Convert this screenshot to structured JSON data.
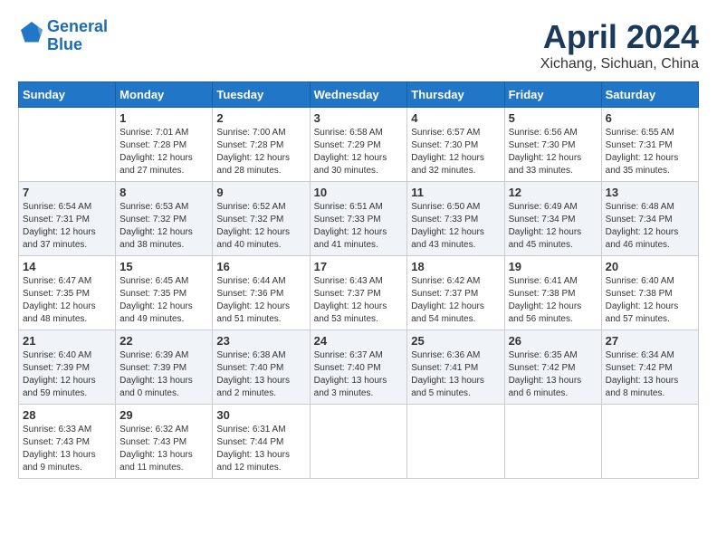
{
  "logo": {
    "line1": "General",
    "line2": "Blue"
  },
  "title": "April 2024",
  "subtitle": "Xichang, Sichuan, China",
  "days_of_week": [
    "Sunday",
    "Monday",
    "Tuesday",
    "Wednesday",
    "Thursday",
    "Friday",
    "Saturday"
  ],
  "weeks": [
    [
      {
        "num": "",
        "info": ""
      },
      {
        "num": "1",
        "info": "Sunrise: 7:01 AM\nSunset: 7:28 PM\nDaylight: 12 hours\nand 27 minutes."
      },
      {
        "num": "2",
        "info": "Sunrise: 7:00 AM\nSunset: 7:28 PM\nDaylight: 12 hours\nand 28 minutes."
      },
      {
        "num": "3",
        "info": "Sunrise: 6:58 AM\nSunset: 7:29 PM\nDaylight: 12 hours\nand 30 minutes."
      },
      {
        "num": "4",
        "info": "Sunrise: 6:57 AM\nSunset: 7:30 PM\nDaylight: 12 hours\nand 32 minutes."
      },
      {
        "num": "5",
        "info": "Sunrise: 6:56 AM\nSunset: 7:30 PM\nDaylight: 12 hours\nand 33 minutes."
      },
      {
        "num": "6",
        "info": "Sunrise: 6:55 AM\nSunset: 7:31 PM\nDaylight: 12 hours\nand 35 minutes."
      }
    ],
    [
      {
        "num": "7",
        "info": "Sunrise: 6:54 AM\nSunset: 7:31 PM\nDaylight: 12 hours\nand 37 minutes."
      },
      {
        "num": "8",
        "info": "Sunrise: 6:53 AM\nSunset: 7:32 PM\nDaylight: 12 hours\nand 38 minutes."
      },
      {
        "num": "9",
        "info": "Sunrise: 6:52 AM\nSunset: 7:32 PM\nDaylight: 12 hours\nand 40 minutes."
      },
      {
        "num": "10",
        "info": "Sunrise: 6:51 AM\nSunset: 7:33 PM\nDaylight: 12 hours\nand 41 minutes."
      },
      {
        "num": "11",
        "info": "Sunrise: 6:50 AM\nSunset: 7:33 PM\nDaylight: 12 hours\nand 43 minutes."
      },
      {
        "num": "12",
        "info": "Sunrise: 6:49 AM\nSunset: 7:34 PM\nDaylight: 12 hours\nand 45 minutes."
      },
      {
        "num": "13",
        "info": "Sunrise: 6:48 AM\nSunset: 7:34 PM\nDaylight: 12 hours\nand 46 minutes."
      }
    ],
    [
      {
        "num": "14",
        "info": "Sunrise: 6:47 AM\nSunset: 7:35 PM\nDaylight: 12 hours\nand 48 minutes."
      },
      {
        "num": "15",
        "info": "Sunrise: 6:45 AM\nSunset: 7:35 PM\nDaylight: 12 hours\nand 49 minutes."
      },
      {
        "num": "16",
        "info": "Sunrise: 6:44 AM\nSunset: 7:36 PM\nDaylight: 12 hours\nand 51 minutes."
      },
      {
        "num": "17",
        "info": "Sunrise: 6:43 AM\nSunset: 7:37 PM\nDaylight: 12 hours\nand 53 minutes."
      },
      {
        "num": "18",
        "info": "Sunrise: 6:42 AM\nSunset: 7:37 PM\nDaylight: 12 hours\nand 54 minutes."
      },
      {
        "num": "19",
        "info": "Sunrise: 6:41 AM\nSunset: 7:38 PM\nDaylight: 12 hours\nand 56 minutes."
      },
      {
        "num": "20",
        "info": "Sunrise: 6:40 AM\nSunset: 7:38 PM\nDaylight: 12 hours\nand 57 minutes."
      }
    ],
    [
      {
        "num": "21",
        "info": "Sunrise: 6:40 AM\nSunset: 7:39 PM\nDaylight: 12 hours\nand 59 minutes."
      },
      {
        "num": "22",
        "info": "Sunrise: 6:39 AM\nSunset: 7:39 PM\nDaylight: 13 hours\nand 0 minutes."
      },
      {
        "num": "23",
        "info": "Sunrise: 6:38 AM\nSunset: 7:40 PM\nDaylight: 13 hours\nand 2 minutes."
      },
      {
        "num": "24",
        "info": "Sunrise: 6:37 AM\nSunset: 7:40 PM\nDaylight: 13 hours\nand 3 minutes."
      },
      {
        "num": "25",
        "info": "Sunrise: 6:36 AM\nSunset: 7:41 PM\nDaylight: 13 hours\nand 5 minutes."
      },
      {
        "num": "26",
        "info": "Sunrise: 6:35 AM\nSunset: 7:42 PM\nDaylight: 13 hours\nand 6 minutes."
      },
      {
        "num": "27",
        "info": "Sunrise: 6:34 AM\nSunset: 7:42 PM\nDaylight: 13 hours\nand 8 minutes."
      }
    ],
    [
      {
        "num": "28",
        "info": "Sunrise: 6:33 AM\nSunset: 7:43 PM\nDaylight: 13 hours\nand 9 minutes."
      },
      {
        "num": "29",
        "info": "Sunrise: 6:32 AM\nSunset: 7:43 PM\nDaylight: 13 hours\nand 11 minutes."
      },
      {
        "num": "30",
        "info": "Sunrise: 6:31 AM\nSunset: 7:44 PM\nDaylight: 13 hours\nand 12 minutes."
      },
      {
        "num": "",
        "info": ""
      },
      {
        "num": "",
        "info": ""
      },
      {
        "num": "",
        "info": ""
      },
      {
        "num": "",
        "info": ""
      }
    ]
  ]
}
